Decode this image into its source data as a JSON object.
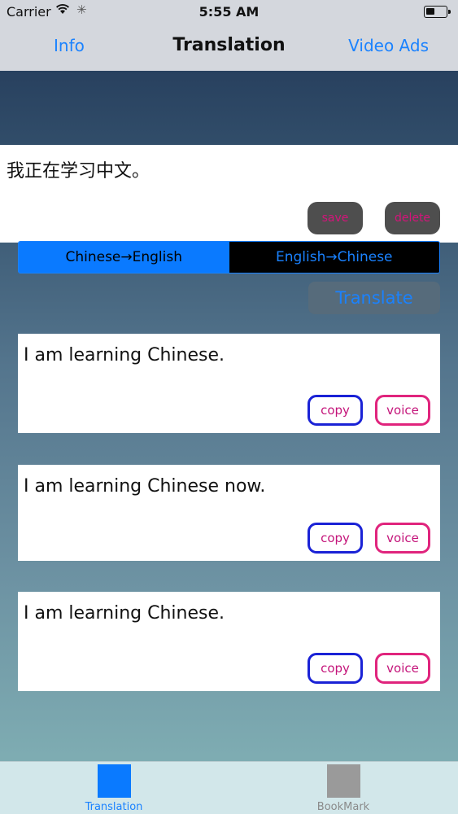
{
  "status_bar": {
    "carrier": "Carrier",
    "time": "5:55 AM",
    "wifi_icon": "wifi-icon",
    "activity_icon": "activity-spinner-icon",
    "battery_icon": "battery-icon"
  },
  "nav": {
    "left": "Info",
    "title": "Translation",
    "right": "Video Ads"
  },
  "input": {
    "text": "我正在学习中文。",
    "save_label": "save",
    "delete_label": "delete"
  },
  "segment": {
    "options": [
      "Chinese→English",
      "English→Chinese"
    ],
    "selected": "Chinese→English"
  },
  "translate_label": "Translate",
  "results": [
    {
      "text": "I am learning Chinese.",
      "copy_label": "copy",
      "voice_label": "voice"
    },
    {
      "text": "I am learning Chinese now.",
      "copy_label": "copy",
      "voice_label": "voice"
    },
    {
      "text": "I am learning Chinese.",
      "copy_label": "copy",
      "voice_label": "voice"
    }
  ],
  "tabs": [
    {
      "label": "Translation",
      "active": true
    },
    {
      "label": "BookMark",
      "active": false
    }
  ],
  "colors": {
    "accent": "#1a82ff",
    "button_text_pink": "#c4147a",
    "copy_border": "#1a22d6",
    "voice_border": "#e0247d"
  }
}
